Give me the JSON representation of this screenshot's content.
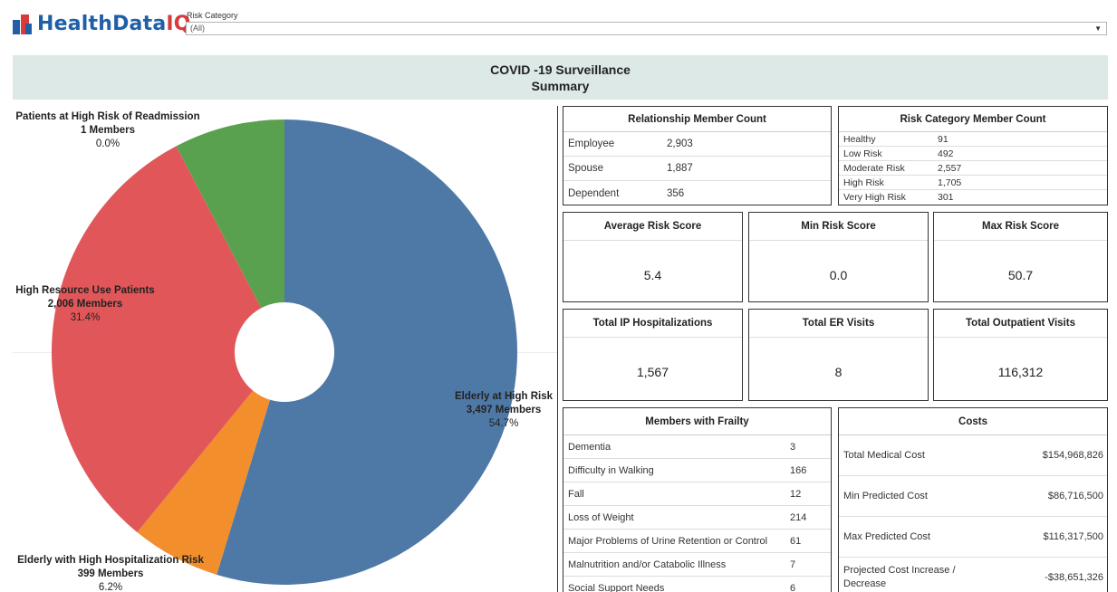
{
  "logo": {
    "text_main": "HealthData",
    "text_accent": "IQ"
  },
  "filter": {
    "label": "Risk Category",
    "value": "(All)"
  },
  "banner": {
    "line1": "COVID -19 Surveillance",
    "line2": "Summary"
  },
  "chart_data": {
    "type": "pie",
    "slices": [
      {
        "name": "Elderly at High Risk",
        "members_label": "3,497 Members",
        "pct_label": "54.7%",
        "value": 54.7,
        "color": "#4e79a7"
      },
      {
        "name": "Elderly with High Hospitalization Risk",
        "members_label": "399 Members",
        "pct_label": "6.2%",
        "value": 6.2,
        "color": "#f28e2b"
      },
      {
        "name": "High Resource Use Patients",
        "members_label": "2,006 Members",
        "pct_label": "31.4%",
        "value": 31.4,
        "color": "#e15759"
      },
      {
        "name": "Patients at High Risk of Readmission",
        "members_label": "1 Members",
        "pct_label": "0.0%",
        "value": 7.7,
        "color": "#59a14f"
      }
    ]
  },
  "relationship": {
    "title": "Relationship Member Count",
    "rows": [
      {
        "label": "Employee",
        "value": "2,903"
      },
      {
        "label": "Spouse",
        "value": "1,887"
      },
      {
        "label": "Dependent",
        "value": "356"
      }
    ]
  },
  "risk_category": {
    "title": "Risk Category Member Count",
    "rows": [
      {
        "label": "Healthy",
        "value": "91"
      },
      {
        "label": "Low Risk",
        "value": "492"
      },
      {
        "label": "Moderate Risk",
        "value": "2,557"
      },
      {
        "label": "High Risk",
        "value": "1,705"
      },
      {
        "label": "Very High Risk",
        "value": "301"
      }
    ]
  },
  "kpis": {
    "avg_risk": {
      "title": "Average Risk Score",
      "value": "5.4"
    },
    "min_risk": {
      "title": "Min Risk Score",
      "value": "0.0"
    },
    "max_risk": {
      "title": "Max Risk Score",
      "value": "50.7"
    },
    "ip_hosp": {
      "title": "Total IP Hospitalizations",
      "value": "1,567"
    },
    "er_visits": {
      "title": "Total ER Visits",
      "value": "8"
    },
    "outpatient": {
      "title": "Total Outpatient Visits",
      "value": "116,312"
    }
  },
  "frailty": {
    "title": "Members with Frailty",
    "rows": [
      {
        "label": "Dementia",
        "value": "3"
      },
      {
        "label": "Difficulty in Walking",
        "value": "166"
      },
      {
        "label": "Fall",
        "value": "12"
      },
      {
        "label": "Loss of Weight",
        "value": "214"
      },
      {
        "label": "Major Problems of Urine Retention or Control",
        "value": "61"
      },
      {
        "label": "Malnutrition and/or Catabolic Illness",
        "value": "7"
      },
      {
        "label": "Social Support Needs",
        "value": "6"
      }
    ]
  },
  "costs": {
    "title": "Costs",
    "rows": [
      {
        "label": "Total Medical Cost",
        "value": "$154,968,826"
      },
      {
        "label": "Min Predicted Cost",
        "value": "$86,716,500"
      },
      {
        "label": "Max Predicted Cost",
        "value": "$116,317,500"
      },
      {
        "label": "Projected Cost Increase / Decrease",
        "value": "-$38,651,326"
      }
    ]
  }
}
